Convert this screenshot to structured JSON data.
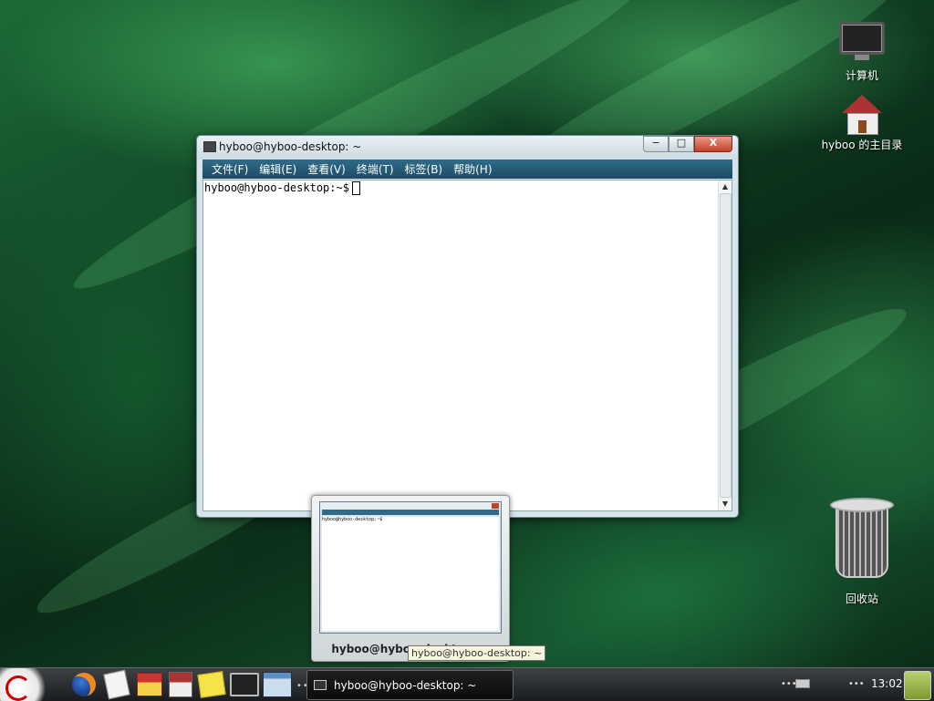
{
  "desktop": {
    "icons": [
      {
        "label": "计算机"
      },
      {
        "label": "hyboo 的主目录"
      },
      {
        "label": "回收站"
      }
    ]
  },
  "window": {
    "title": "hyboo@hyboo-desktop: ~",
    "buttons": {
      "minimize": "−",
      "maximize": "□",
      "close": "X"
    },
    "menu": [
      "文件(F)",
      "编辑(E)",
      "查看(V)",
      "终端(T)",
      "标签(B)",
      "帮助(H)"
    ],
    "prompt": "hyboo@hyboo-desktop:~$"
  },
  "preview": {
    "label": "hyboo@hyboo-desktop: ~",
    "mini_prompt": "hyboo@hyboo-desktop:~$",
    "tooltip": "hyboo@hyboo-desktop: ~"
  },
  "panel": {
    "launchers": [
      "firefox-icon",
      "text-editor-icon",
      "home-folder-icon",
      "home-icon",
      "notes-icon",
      "terminal-icon",
      "workspace-icon"
    ],
    "task_label": "hyboo@hyboo-desktop: ~",
    "clock": "13:02"
  }
}
